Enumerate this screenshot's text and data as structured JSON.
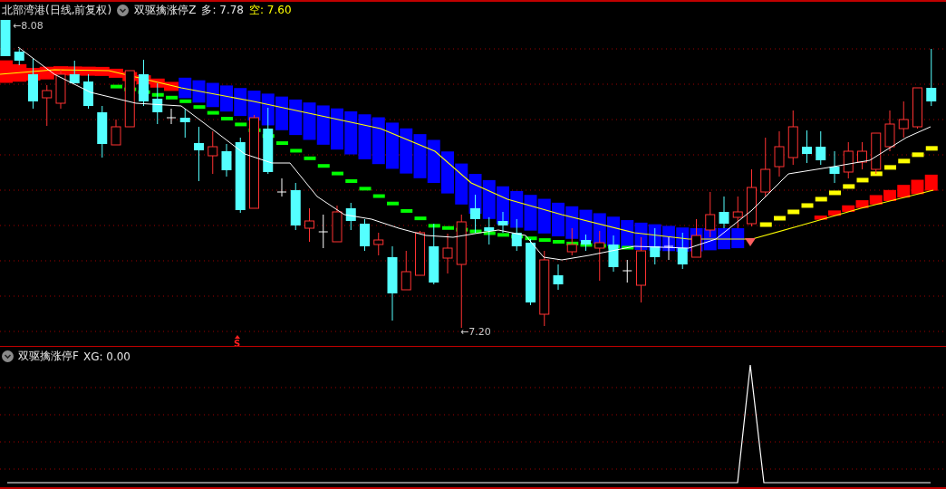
{
  "main_panel": {
    "title": "北部湾港(日线,前复权)",
    "indicator": "双驱擒涨停Z",
    "readings": [
      {
        "text": "多: 7.78",
        "color": "#e6e6e6"
      },
      {
        "text": "空: 7.60",
        "color": "#ffff00"
      }
    ],
    "high_label": "←8.08",
    "low_label": "←7.20",
    "signal_mark": "S"
  },
  "sub_panel": {
    "indicator": "双驱擒涨停F",
    "reading": "XG: 0.00"
  }
}
